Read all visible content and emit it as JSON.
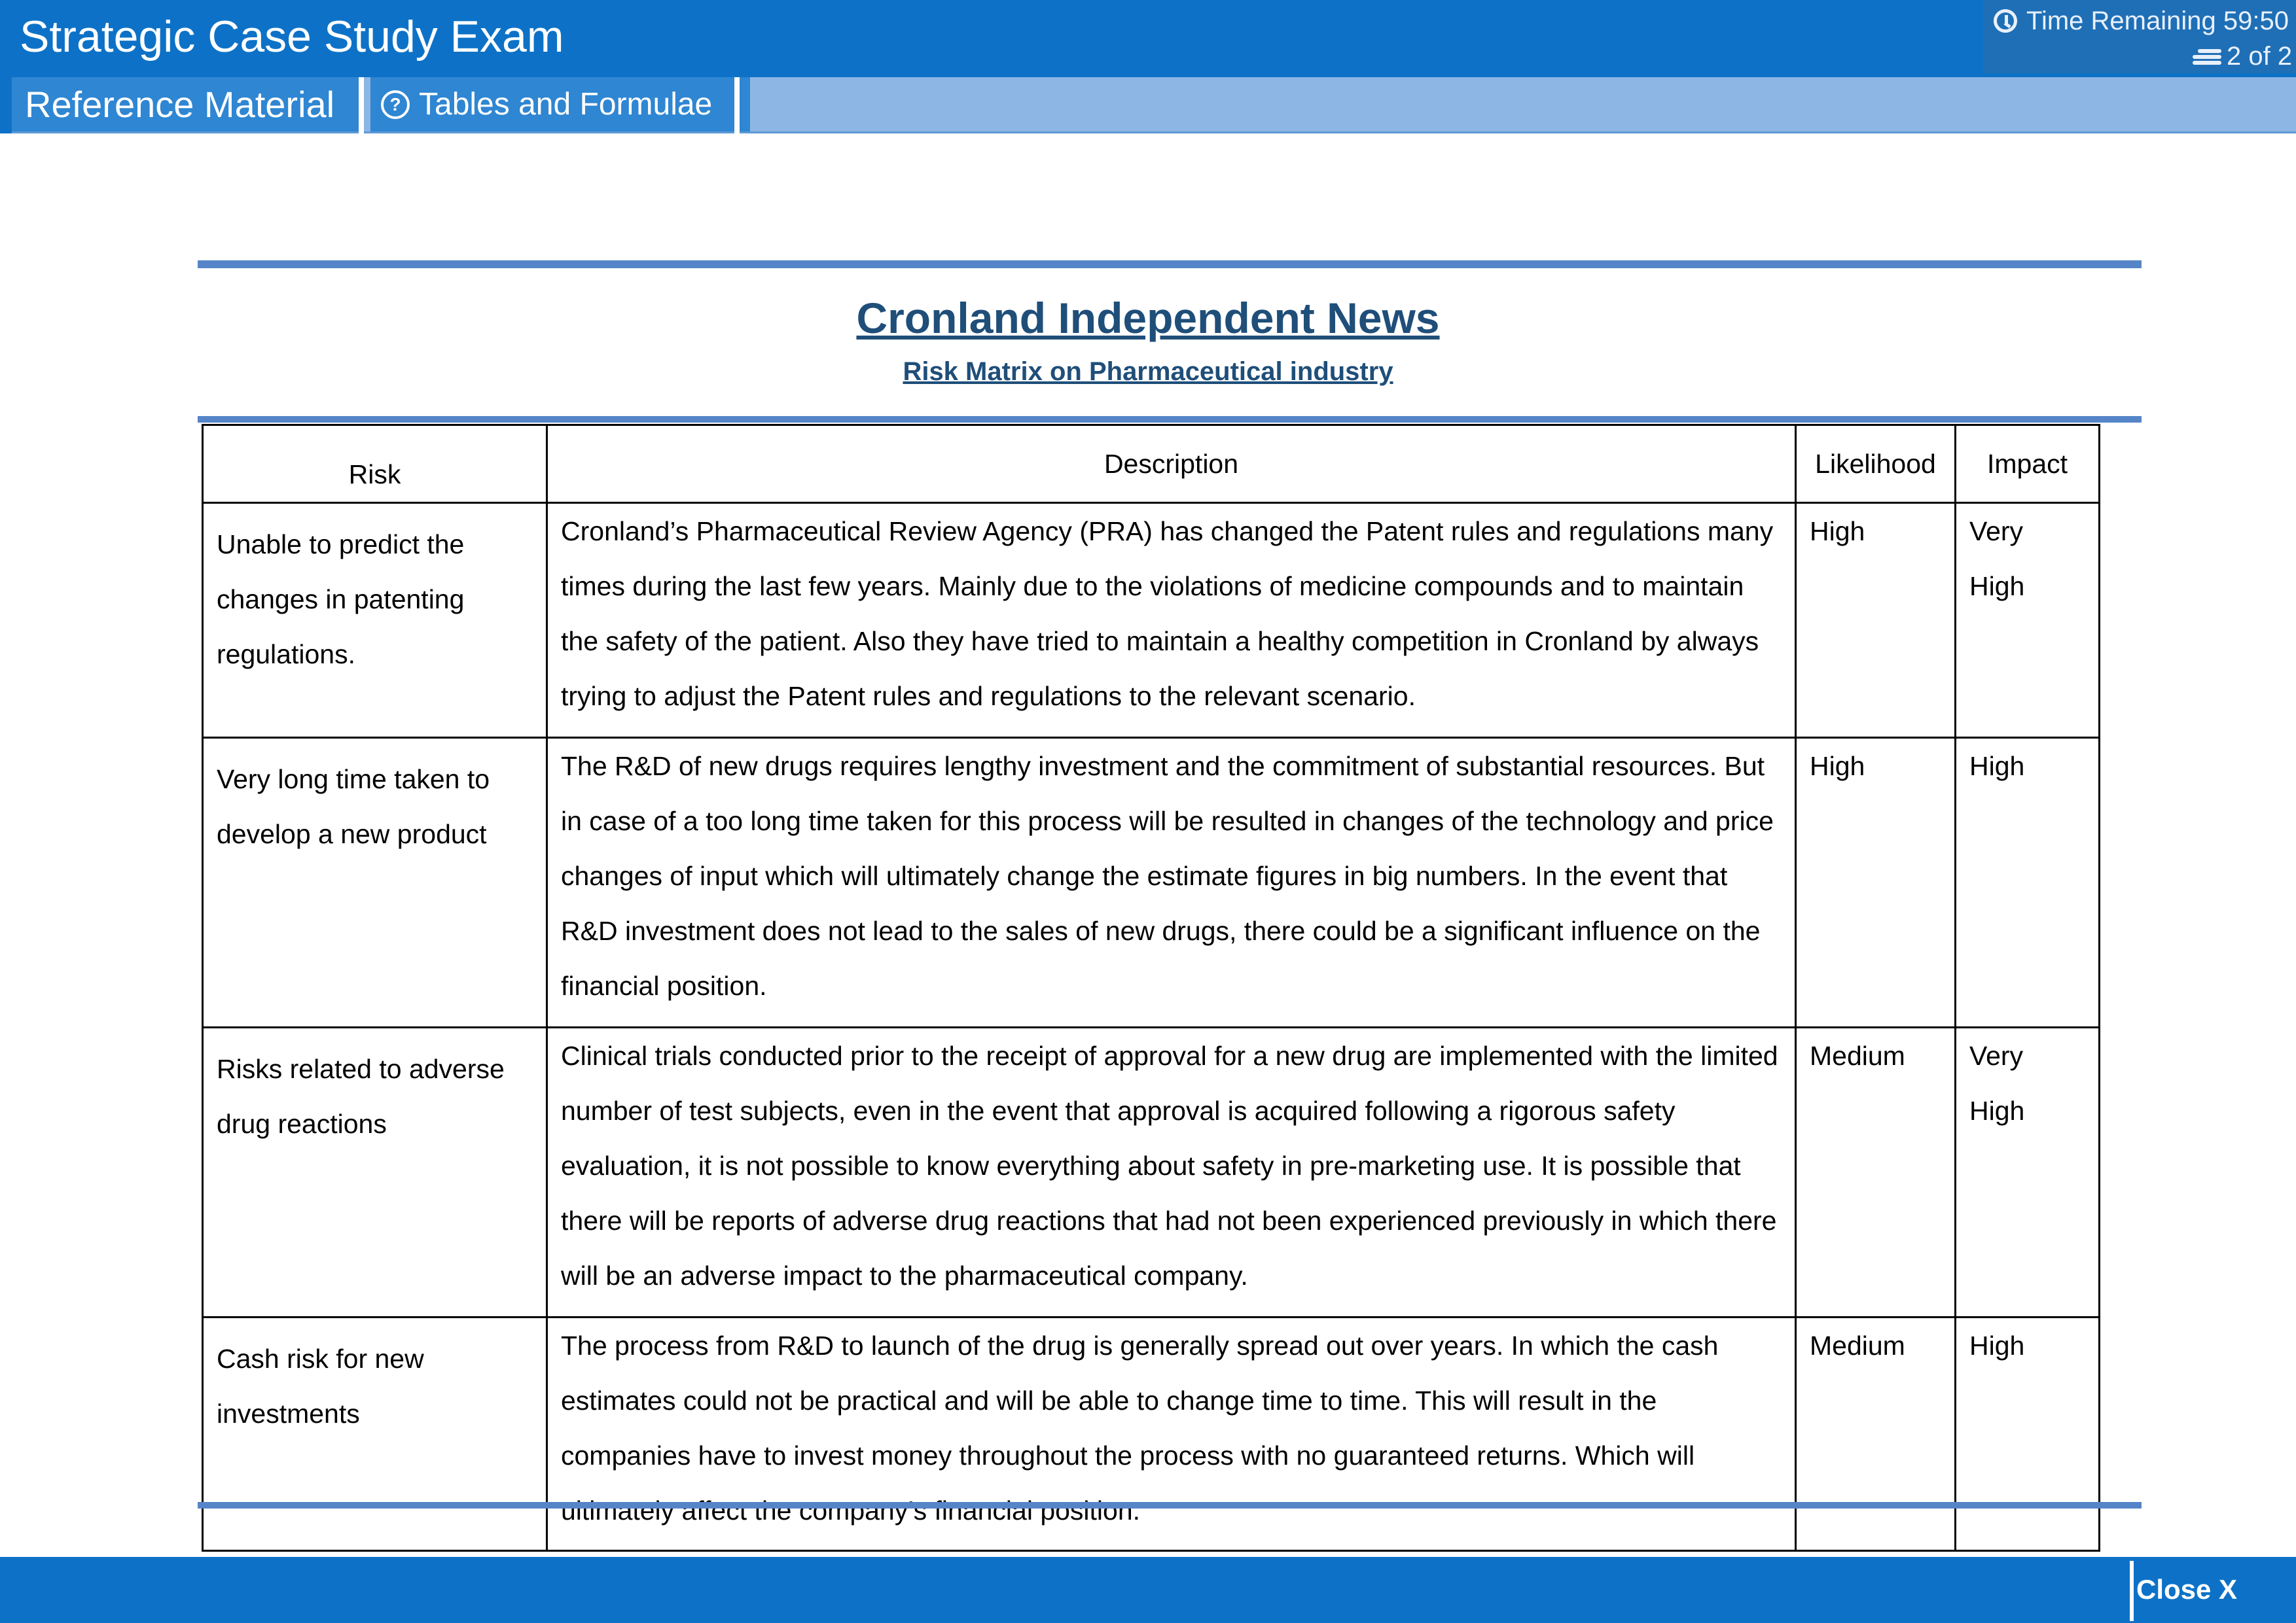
{
  "header": {
    "exam_title": "Strategic Case Study Exam",
    "timer_label": "Time Remaining 59:50",
    "page_indicator": "2 of 2",
    "timer_icon": "clock-icon",
    "page_icon": "pages-icon"
  },
  "subnav": {
    "reference_tab": "Reference Material",
    "tables_tab": "Tables and Formulae",
    "tables_icon": "help-circle-icon"
  },
  "document": {
    "title": "Cronland Independent News",
    "subtitle": "Risk Matrix on Pharmaceutical industry"
  },
  "table": {
    "headers": {
      "risk": "Risk",
      "description": "Description",
      "likelihood": "Likelihood",
      "impact": "Impact"
    },
    "rows": [
      {
        "risk": "Unable to predict the changes in patenting regulations.",
        "description": "Cronland’s Pharmaceutical Review Agency (PRA) has changed the Patent rules and regulations many times during the last few years. Mainly due to the violations of medicine compounds and to maintain the safety of the patient. Also they have tried to maintain a healthy competition in Cronland by always trying to adjust the Patent rules and regulations to the relevant scenario.",
        "likelihood": "High",
        "impact": "Very High"
      },
      {
        "risk": "Very long time taken to develop a new product",
        "description": "The R&D of new drugs requires lengthy investment and the commitment of substantial resources. But in case of a too long time taken for this process will be resulted in changes of the technology and price changes of input which will ultimately change the estimate figures in big numbers. In the event that R&D investment does not lead to the sales of new drugs, there could be a significant influence on the financial position.",
        "likelihood": "High",
        "impact": "High"
      },
      {
        "risk": "Risks related to adverse drug reactions",
        "description": "Clinical trials conducted prior to the receipt of approval for a new drug are implemented with the limited number of test subjects, even in the event that approval is acquired following a rigorous safety evaluation, it is not possible to know everything about safety in pre-marketing use. It is possible that there will be reports of adverse drug reactions that had not been experienced previously in which there will be an adverse impact to the pharmaceutical company.",
        "likelihood": "Medium",
        "impact": "Very High"
      },
      {
        "risk": "Cash risk for new investments",
        "description": "The process from R&D to launch of the drug is generally spread out over years. In which the cash estimates could not be practical and will be able to change time to time. This will result in the companies have to invest money throughout the process with no guaranteed returns. Which will ultimately affect the company’s financial position.",
        "likelihood": "Medium",
        "impact": "High"
      }
    ]
  },
  "footer": {
    "close_label": "Close X"
  },
  "colors": {
    "header_blue": "#0d72c7",
    "subnav_blue": "#8db6e5",
    "tab_blue": "#2f86d2",
    "title_navy": "#1f4e79",
    "rule_blue": "#5585c8"
  }
}
